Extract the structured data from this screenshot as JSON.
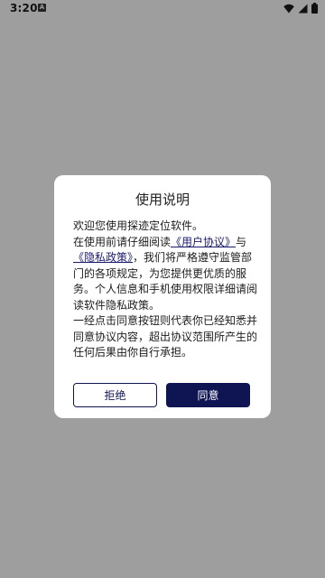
{
  "status_bar": {
    "time": "3:20",
    "notification_icon": "A"
  },
  "colors": {
    "overlay": "#9e9e9e",
    "dialog_bg": "#ffffff",
    "primary": "#0f1452",
    "link": "#1a1a6e"
  },
  "dialog": {
    "title": "使用说明",
    "welcome": "欢迎您使用探迹定位软件。",
    "read_prefix": "在使用前请仔细阅读",
    "user_agreement_link": "《用户协议》",
    "and_text": "与",
    "privacy_policy_link": "《隐私政策》",
    "read_suffix": "，我们将严格遵守监管部门的各项规定，为您提供更优质的服务。个人信息和手机使用权限详细请阅读软件隐私政策。",
    "consent_text": "一经点击同意按钮则代表你已经知悉并同意协议内容，超出协议范围所产生的任何后果由你自行承担。",
    "refuse_button": "拒绝",
    "agree_button": "同意"
  }
}
